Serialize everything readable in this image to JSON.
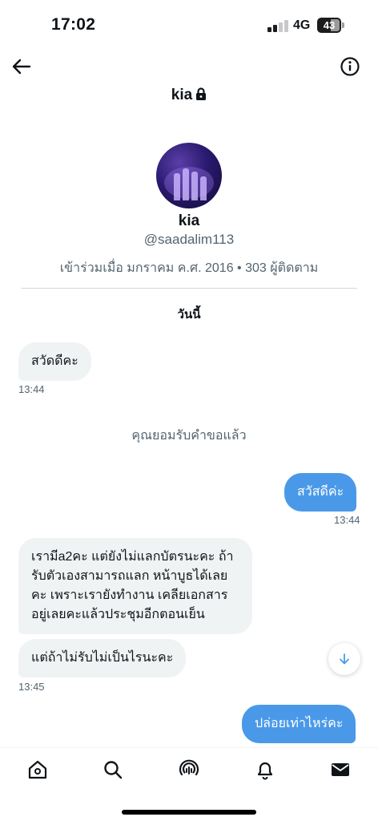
{
  "status_bar": {
    "time": "17:02",
    "network": "4G",
    "battery": "43"
  },
  "header": {
    "title": "kia"
  },
  "profile": {
    "name": "kia",
    "handle": "@saadalim113",
    "meta": "เข้าร่วมเมื่อ มกราคม ค.ศ. 2016 • 303 ผู้ติดตาม"
  },
  "conversation": {
    "day_label": "วันนี้",
    "system_message": "คุณยอมรับคำขอแล้ว",
    "messages": [
      {
        "direction": "in",
        "text": "สวัดดีคะ",
        "time": "13:44"
      },
      {
        "direction": "out",
        "text": "สวัสดีค่ะ",
        "time": "13:44"
      },
      {
        "direction": "in",
        "lines": [
          "เรามีa2คะ แต่ยังไม่แลกบัตรนะคะ ถ้า",
          "รับตัวเองสามารถแลก หน้าบูธได้เลย",
          "คะ เพราะเรายังทำงาน เคลียเอกสาร",
          "อยู่เลยคะแล้วประชุมอีกตอนเย็น"
        ]
      },
      {
        "direction": "in",
        "text": "แต่ถ้าไม่รับไม่เป็นไรนะคะ",
        "time": "13:45"
      },
      {
        "direction": "out",
        "text": "ปล่อยเท่าไหร่คะ"
      }
    ]
  },
  "tabbar": {
    "items": [
      {
        "icon": "home-icon"
      },
      {
        "icon": "search-icon"
      },
      {
        "icon": "spaces-icon"
      },
      {
        "icon": "bell-icon"
      },
      {
        "icon": "mail-icon"
      }
    ]
  },
  "colors": {
    "accent": "#4a99e9",
    "incoming_bubble": "#eff3f4",
    "muted_text": "#536471"
  }
}
